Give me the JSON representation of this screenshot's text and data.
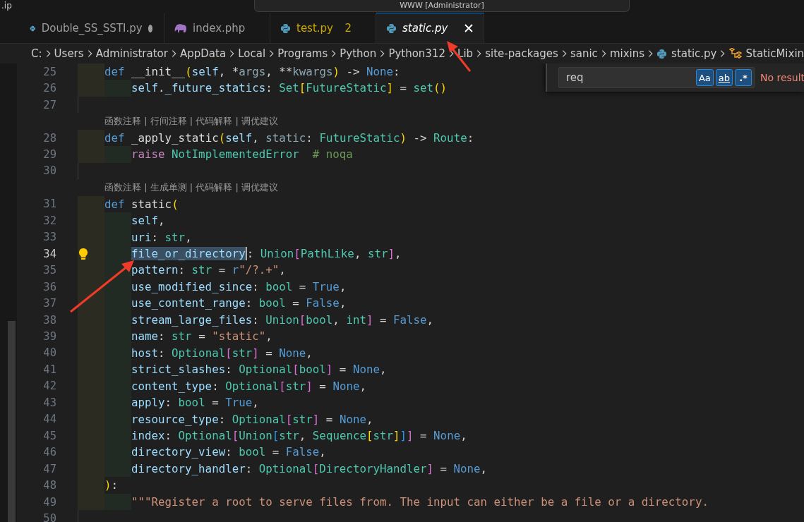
{
  "title_bar": {
    "left_text": ".ip",
    "command_center": "WWW [Administrator]"
  },
  "tabs": [
    {
      "label": "Double_SS_SSTI.py",
      "kind": "python",
      "selected": false,
      "preview": false,
      "modified": true
    },
    {
      "label": "index.php",
      "kind": "php",
      "selected": false,
      "preview": false,
      "modified": false
    },
    {
      "label": "test.py",
      "kind": "python",
      "selected": false,
      "preview": false,
      "modified": false,
      "badge": "2"
    },
    {
      "label": "static.py",
      "kind": "python",
      "selected": true,
      "preview": true,
      "modified": false
    }
  ],
  "breadcrumb": [
    {
      "text": "C:",
      "kind": "folder"
    },
    {
      "text": "Users",
      "kind": "folder"
    },
    {
      "text": "Administrator",
      "kind": "folder"
    },
    {
      "text": "AppData",
      "kind": "folder"
    },
    {
      "text": "Local",
      "kind": "folder"
    },
    {
      "text": "Programs",
      "kind": "folder"
    },
    {
      "text": "Python",
      "kind": "folder"
    },
    {
      "text": "Python312",
      "kind": "folder"
    },
    {
      "text": "Lib",
      "kind": "folder"
    },
    {
      "text": "site-packages",
      "kind": "folder"
    },
    {
      "text": "sanic",
      "kind": "folder"
    },
    {
      "text": "mixins",
      "kind": "folder"
    },
    {
      "text": "static.py",
      "kind": "python"
    },
    {
      "text": "StaticMixin",
      "kind": "class"
    }
  ],
  "find": {
    "value": "req",
    "toggles": [
      {
        "label": "Aa",
        "on": true
      },
      {
        "label": "ab",
        "on": true
      },
      {
        "label": ".*",
        "on": true
      }
    ],
    "result": "No result"
  },
  "lines": [
    {
      "kind": "code",
      "number": "25",
      "current": false,
      "lightbulb": false,
      "tokens": [
        {
          "text": "    def ",
          "kind": "kw"
        },
        {
          "text": "__init__",
          "kind": "fn"
        },
        {
          "text": "(",
          "kind": "b1"
        },
        {
          "text": "self",
          "kind": "param"
        },
        {
          "text": ", *",
          "kind": "p"
        },
        {
          "text": "args",
          "kind": "dim"
        },
        {
          "text": ", **",
          "kind": "p"
        },
        {
          "text": "kwargs",
          "kind": "dim"
        },
        {
          "text": ")",
          "kind": "b1"
        },
        {
          "text": " -> ",
          "kind": "p"
        },
        {
          "text": "None",
          "kind": "const"
        },
        {
          "text": ":",
          "kind": "p"
        }
      ]
    },
    {
      "kind": "code",
      "number": "26",
      "current": false,
      "lightbulb": false,
      "tokens": [
        {
          "text": "        self",
          "kind": "param"
        },
        {
          "text": ".",
          "kind": "p"
        },
        {
          "text": "_future_statics",
          "kind": "param"
        },
        {
          "text": ": ",
          "kind": "p"
        },
        {
          "text": "Set",
          "kind": "type"
        },
        {
          "text": "[",
          "kind": "b1"
        },
        {
          "text": "FutureStatic",
          "kind": "type"
        },
        {
          "text": "]",
          "kind": "b1"
        },
        {
          "text": " = ",
          "kind": "p"
        },
        {
          "text": "set",
          "kind": "type"
        },
        {
          "text": "()",
          "kind": "b1"
        }
      ]
    },
    {
      "kind": "code",
      "number": "27",
      "current": false,
      "lightbulb": false
    },
    {
      "kind": "lens",
      "text": "函数注释 | 行间注释 | 代码解释 | 调优建议"
    },
    {
      "kind": "code",
      "number": "28",
      "current": false,
      "lightbulb": false,
      "tokens": [
        {
          "text": "    def ",
          "kind": "kw"
        },
        {
          "text": "_apply_static",
          "kind": "fn"
        },
        {
          "text": "(",
          "kind": "b1"
        },
        {
          "text": "self",
          "kind": "param"
        },
        {
          "text": ", ",
          "kind": "p"
        },
        {
          "text": "static",
          "kind": "dim"
        },
        {
          "text": ": ",
          "kind": "p"
        },
        {
          "text": "FutureStatic",
          "kind": "type"
        },
        {
          "text": ")",
          "kind": "b1"
        },
        {
          "text": " -> ",
          "kind": "p"
        },
        {
          "text": "Route",
          "kind": "type"
        },
        {
          "text": ":",
          "kind": "p"
        }
      ]
    },
    {
      "kind": "code",
      "number": "29",
      "current": false,
      "lightbulb": false,
      "tokens": [
        {
          "text": "        raise ",
          "kind": "ctrl"
        },
        {
          "text": "NotImplementedError",
          "kind": "type"
        },
        {
          "text": "  # noqa",
          "kind": "comment"
        }
      ]
    },
    {
      "kind": "code",
      "number": "30",
      "current": false,
      "lightbulb": false
    },
    {
      "kind": "lens",
      "text": "函数注释 | 生成单测 | 代码解释 | 调优建议"
    },
    {
      "kind": "code",
      "number": "31",
      "current": false,
      "lightbulb": false,
      "tokens": [
        {
          "text": "    def ",
          "kind": "kw"
        },
        {
          "text": "static",
          "kind": "fn"
        },
        {
          "text": "(",
          "kind": "b1"
        }
      ]
    },
    {
      "kind": "code",
      "number": "32",
      "current": false,
      "lightbulb": false,
      "tokens": [
        {
          "text": "        self",
          "kind": "param"
        },
        {
          "text": ",",
          "kind": "p"
        }
      ]
    },
    {
      "kind": "code",
      "number": "33",
      "current": false,
      "lightbulb": false,
      "tokens": [
        {
          "text": "        uri",
          "kind": "param"
        },
        {
          "text": ": ",
          "kind": "p"
        },
        {
          "text": "str",
          "kind": "type"
        },
        {
          "text": ",",
          "kind": "p"
        }
      ]
    },
    {
      "kind": "code",
      "number": "34",
      "current": true,
      "lightbulb": true,
      "tokens": [
        {
          "text": "        file_or_directory",
          "kind": "sel"
        },
        {
          "text": ": ",
          "kind": "p"
        },
        {
          "text": "Union",
          "kind": "type"
        },
        {
          "text": "[",
          "kind": "b2"
        },
        {
          "text": "PathLike",
          "kind": "type"
        },
        {
          "text": ", ",
          "kind": "p"
        },
        {
          "text": "str",
          "kind": "type"
        },
        {
          "text": "]",
          "kind": "b2"
        },
        {
          "text": ",",
          "kind": "p"
        }
      ]
    },
    {
      "kind": "code",
      "number": "35",
      "current": false,
      "lightbulb": false,
      "tokens": [
        {
          "text": "        pattern",
          "kind": "param"
        },
        {
          "text": ": ",
          "kind": "p"
        },
        {
          "text": "str",
          "kind": "type"
        },
        {
          "text": " = ",
          "kind": "p"
        },
        {
          "text": "r",
          "kind": "kw"
        },
        {
          "text": "\"/?.+\"",
          "kind": "string"
        },
        {
          "text": ",",
          "kind": "p"
        }
      ]
    },
    {
      "kind": "code",
      "number": "36",
      "current": false,
      "lightbulb": false,
      "tokens": [
        {
          "text": "        use_modified_since",
          "kind": "param"
        },
        {
          "text": ": ",
          "kind": "p"
        },
        {
          "text": "bool",
          "kind": "type"
        },
        {
          "text": " = ",
          "kind": "p"
        },
        {
          "text": "True",
          "kind": "const"
        },
        {
          "text": ",",
          "kind": "p"
        }
      ]
    },
    {
      "kind": "code",
      "number": "37",
      "current": false,
      "lightbulb": false,
      "tokens": [
        {
          "text": "        use_content_range",
          "kind": "param"
        },
        {
          "text": ": ",
          "kind": "p"
        },
        {
          "text": "bool",
          "kind": "type"
        },
        {
          "text": " = ",
          "kind": "p"
        },
        {
          "text": "False",
          "kind": "const"
        },
        {
          "text": ",",
          "kind": "p"
        }
      ]
    },
    {
      "kind": "code",
      "number": "38",
      "current": false,
      "lightbulb": false,
      "tokens": [
        {
          "text": "        stream_large_files",
          "kind": "param"
        },
        {
          "text": ": ",
          "kind": "p"
        },
        {
          "text": "Union",
          "kind": "type"
        },
        {
          "text": "[",
          "kind": "b2"
        },
        {
          "text": "bool",
          "kind": "type"
        },
        {
          "text": ", ",
          "kind": "p"
        },
        {
          "text": "int",
          "kind": "type"
        },
        {
          "text": "]",
          "kind": "b2"
        },
        {
          "text": " = ",
          "kind": "p"
        },
        {
          "text": "False",
          "kind": "const"
        },
        {
          "text": ",",
          "kind": "p"
        }
      ]
    },
    {
      "kind": "code",
      "number": "39",
      "current": false,
      "lightbulb": false,
      "tokens": [
        {
          "text": "        name",
          "kind": "param"
        },
        {
          "text": ": ",
          "kind": "p"
        },
        {
          "text": "str",
          "kind": "type"
        },
        {
          "text": " = ",
          "kind": "p"
        },
        {
          "text": "\"static\"",
          "kind": "string"
        },
        {
          "text": ",",
          "kind": "p"
        }
      ]
    },
    {
      "kind": "code",
      "number": "40",
      "current": false,
      "lightbulb": false,
      "tokens": [
        {
          "text": "        host",
          "kind": "param"
        },
        {
          "text": ": ",
          "kind": "p"
        },
        {
          "text": "Optional",
          "kind": "type"
        },
        {
          "text": "[",
          "kind": "b2"
        },
        {
          "text": "str",
          "kind": "type"
        },
        {
          "text": "]",
          "kind": "b2"
        },
        {
          "text": " = ",
          "kind": "p"
        },
        {
          "text": "None",
          "kind": "const"
        },
        {
          "text": ",",
          "kind": "p"
        }
      ]
    },
    {
      "kind": "code",
      "number": "41",
      "current": false,
      "lightbulb": false,
      "tokens": [
        {
          "text": "        strict_slashes",
          "kind": "param"
        },
        {
          "text": ": ",
          "kind": "p"
        },
        {
          "text": "Optional",
          "kind": "type"
        },
        {
          "text": "[",
          "kind": "b2"
        },
        {
          "text": "bool",
          "kind": "type"
        },
        {
          "text": "]",
          "kind": "b2"
        },
        {
          "text": " = ",
          "kind": "p"
        },
        {
          "text": "None",
          "kind": "const"
        },
        {
          "text": ",",
          "kind": "p"
        }
      ]
    },
    {
      "kind": "code",
      "number": "42",
      "current": false,
      "lightbulb": false,
      "tokens": [
        {
          "text": "        content_type",
          "kind": "param"
        },
        {
          "text": ": ",
          "kind": "p"
        },
        {
          "text": "Optional",
          "kind": "type"
        },
        {
          "text": "[",
          "kind": "b2"
        },
        {
          "text": "str",
          "kind": "type"
        },
        {
          "text": "]",
          "kind": "b2"
        },
        {
          "text": " = ",
          "kind": "p"
        },
        {
          "text": "None",
          "kind": "const"
        },
        {
          "text": ",",
          "kind": "p"
        }
      ]
    },
    {
      "kind": "code",
      "number": "43",
      "current": false,
      "lightbulb": false,
      "tokens": [
        {
          "text": "        apply",
          "kind": "param"
        },
        {
          "text": ": ",
          "kind": "p"
        },
        {
          "text": "bool",
          "kind": "type"
        },
        {
          "text": " = ",
          "kind": "p"
        },
        {
          "text": "True",
          "kind": "const"
        },
        {
          "text": ",",
          "kind": "p"
        }
      ]
    },
    {
      "kind": "code",
      "number": "44",
      "current": false,
      "lightbulb": false,
      "tokens": [
        {
          "text": "        resource_type",
          "kind": "param"
        },
        {
          "text": ": ",
          "kind": "p"
        },
        {
          "text": "Optional",
          "kind": "type"
        },
        {
          "text": "[",
          "kind": "b2"
        },
        {
          "text": "str",
          "kind": "type"
        },
        {
          "text": "]",
          "kind": "b2"
        },
        {
          "text": " = ",
          "kind": "p"
        },
        {
          "text": "None",
          "kind": "const"
        },
        {
          "text": ",",
          "kind": "p"
        }
      ]
    },
    {
      "kind": "code",
      "number": "45",
      "current": false,
      "lightbulb": false,
      "tokens": [
        {
          "text": "        index",
          "kind": "param"
        },
        {
          "text": ": ",
          "kind": "p"
        },
        {
          "text": "Optional",
          "kind": "type"
        },
        {
          "text": "[",
          "kind": "b2"
        },
        {
          "text": "Union",
          "kind": "type"
        },
        {
          "text": "[",
          "kind": "b3"
        },
        {
          "text": "str",
          "kind": "type"
        },
        {
          "text": ", ",
          "kind": "p"
        },
        {
          "text": "Sequence",
          "kind": "type"
        },
        {
          "text": "[",
          "kind": "b1"
        },
        {
          "text": "str",
          "kind": "type"
        },
        {
          "text": "]",
          "kind": "b1"
        },
        {
          "text": "]",
          "kind": "b3"
        },
        {
          "text": "]",
          "kind": "b2"
        },
        {
          "text": " = ",
          "kind": "p"
        },
        {
          "text": "None",
          "kind": "const"
        },
        {
          "text": ",",
          "kind": "p"
        }
      ]
    },
    {
      "kind": "code",
      "number": "46",
      "current": false,
      "lightbulb": false,
      "tokens": [
        {
          "text": "        directory_view",
          "kind": "param"
        },
        {
          "text": ": ",
          "kind": "p"
        },
        {
          "text": "bool",
          "kind": "type"
        },
        {
          "text": " = ",
          "kind": "p"
        },
        {
          "text": "False",
          "kind": "const"
        },
        {
          "text": ",",
          "kind": "p"
        }
      ]
    },
    {
      "kind": "code",
      "number": "47",
      "current": false,
      "lightbulb": false,
      "tokens": [
        {
          "text": "        directory_handler",
          "kind": "param"
        },
        {
          "text": ": ",
          "kind": "p"
        },
        {
          "text": "Optional",
          "kind": "type"
        },
        {
          "text": "[",
          "kind": "b2"
        },
        {
          "text": "DirectoryHandler",
          "kind": "type"
        },
        {
          "text": "]",
          "kind": "b2"
        },
        {
          "text": " = ",
          "kind": "p"
        },
        {
          "text": "None",
          "kind": "const"
        },
        {
          "text": ",",
          "kind": "p"
        }
      ]
    },
    {
      "kind": "code",
      "number": "48",
      "current": false,
      "lightbulb": false,
      "tokens": [
        {
          "text": "    )",
          "kind": "b1"
        },
        {
          "text": ":",
          "kind": "p"
        }
      ]
    },
    {
      "kind": "code",
      "number": "49",
      "current": false,
      "lightbulb": false,
      "tokens": [
        {
          "text": "        \"\"\"Register a root to serve files from. The input can either be a file or a directory.",
          "kind": "string"
        }
      ]
    },
    {
      "kind": "code",
      "number": "50",
      "current": false,
      "lightbulb": false
    }
  ]
}
